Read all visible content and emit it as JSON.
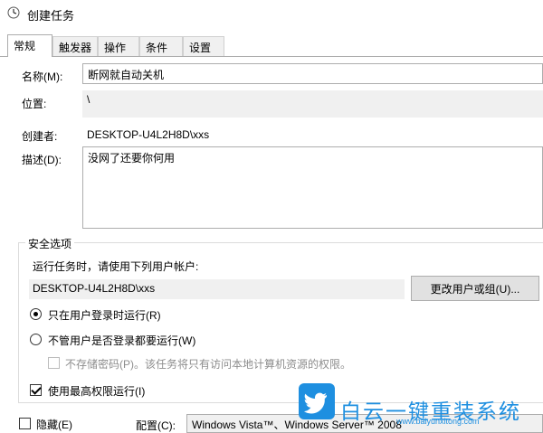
{
  "window": {
    "title": "创建任务",
    "icon": "task-scheduler-icon"
  },
  "tabs": [
    {
      "label": "常规",
      "active": true
    },
    {
      "label": "触发器"
    },
    {
      "label": "操作"
    },
    {
      "label": "条件"
    },
    {
      "label": "设置"
    }
  ],
  "general": {
    "name_label": "名称(M):",
    "name_value": "断网就自动关机",
    "location_label": "位置:",
    "location_value": "\\",
    "author_label": "创建者:",
    "author_value": "DESKTOP-U4L2H8D\\xxs",
    "description_label": "描述(D):",
    "description_value": "没网了还要你何用"
  },
  "security": {
    "legend": "安全选项",
    "run_as_prompt": "运行任务时，请使用下列用户帐户:",
    "account": "DESKTOP-U4L2H8D\\xxs",
    "change_button": "更改用户或组(U)...",
    "radio_logged_on": "只在用户登录时运行(R)",
    "radio_whether": "不管用户是否登录都要运行(W)",
    "no_store_password": "不存储密码(P)。该任务将只有访问本地计算机资源的权限。",
    "highest_privileges": "使用最高权限运行(I)"
  },
  "bottom": {
    "hidden_label": "隐藏(E)",
    "config_label": "配置(C):",
    "config_value": "Windows Vista™、Windows Server™ 2008"
  },
  "watermark": {
    "text": "白云一键重装系统",
    "url": "www.baiyunxitong.com",
    "color": "#1e8fe0"
  }
}
